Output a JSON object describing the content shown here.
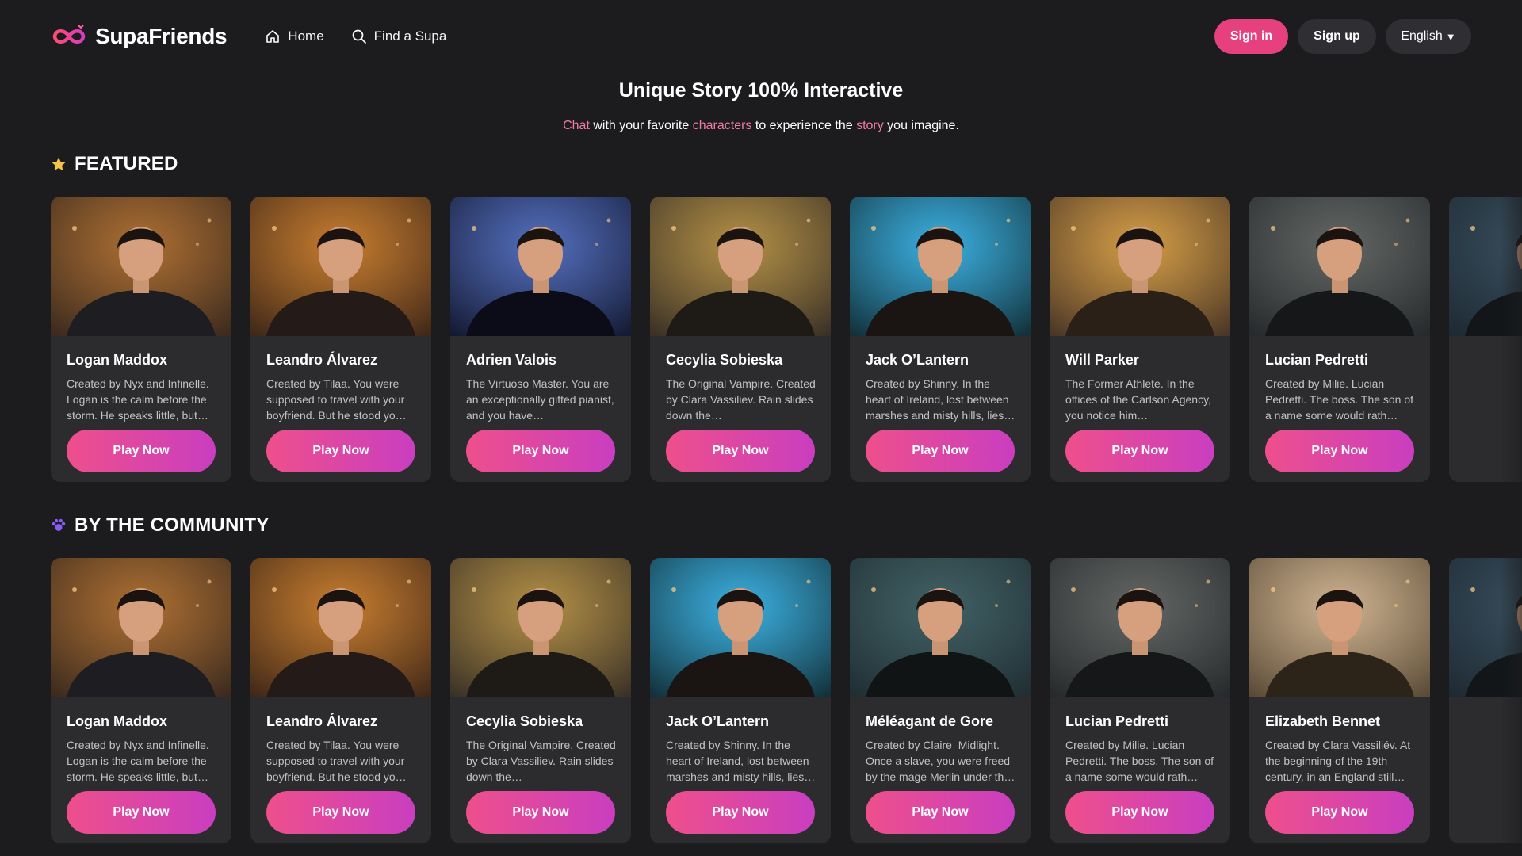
{
  "header": {
    "brand": "SupaFriends",
    "logo_icon": "infinity-heart-logo",
    "nav": [
      {
        "label": "Home",
        "icon": "home-icon"
      },
      {
        "label": "Find a Supa",
        "icon": "search-icon"
      }
    ],
    "sign_in": "Sign in",
    "sign_up": "Sign up",
    "language": "English",
    "language_caret": "▼"
  },
  "hero": {
    "title": "Unique Story 100% Interactive",
    "sub_w1": "Chat",
    "sub_t1": " with your favorite ",
    "sub_w2": "characters",
    "sub_t2": " to experience the ",
    "sub_w3": "story",
    "sub_t3": " you imagine."
  },
  "colors": {
    "accent": "#e6417e",
    "highlight": "#f07aa8",
    "gradient_start": "#ee4f8c",
    "gradient_end": "#c93ec0",
    "card_bg": "#2c2c2e",
    "page_bg": "#1c1c1e",
    "featured_star": "#f5c542",
    "community_icon": "#8a5cf6"
  },
  "featured": {
    "title": "FEATURED",
    "icon": "star-icon",
    "cards": [
      {
        "name": "Logan Maddox",
        "desc": "Created by Nyx and Infinelle. Logan is the calm before the storm. He speaks little, but…",
        "cta": "Play Now"
      },
      {
        "name": "Leandro Álvarez",
        "desc": "Created by Tilaa. You were supposed to travel with your boyfriend. But he stood yo…",
        "cta": "Play Now"
      },
      {
        "name": "Adrien Valois",
        "desc": "The Virtuoso Master. You are an exceptionally gifted pianist, and you have…",
        "cta": "Play Now"
      },
      {
        "name": "Cecylia Sobieska",
        "desc": "The Original Vampire. Created by Clara Vassiliev. Rain slides down the…",
        "cta": "Play Now"
      },
      {
        "name": "Jack O’Lantern",
        "desc": "Created by Shinny. In the heart of Ireland, lost between marshes and misty hills, lies…",
        "cta": "Play Now"
      },
      {
        "name": "Will Parker",
        "desc": "The Former Athlete. In the offices of the Carlson Agency, you notice him…",
        "cta": "Play Now"
      },
      {
        "name": "Lucian Pedretti",
        "desc": "Created by Milie. Lucian Pedretti. The boss. The son of a name some would rath…",
        "cta": "Play Now"
      }
    ]
  },
  "community": {
    "title": "BY THE COMMUNITY",
    "icon": "community-paw-icon",
    "cards": [
      {
        "name": "Logan Maddox",
        "desc": "Created by Nyx and Infinelle. Logan is the calm before the storm. He speaks little, but…",
        "cta": "Play Now"
      },
      {
        "name": "Leandro Álvarez",
        "desc": "Created by Tilaa. You were supposed to travel with your boyfriend. But he stood yo…",
        "cta": "Play Now"
      },
      {
        "name": "Cecylia Sobieska",
        "desc": "The Original Vampire. Created by Clara Vassiliev. Rain slides down the…",
        "cta": "Play Now"
      },
      {
        "name": "Jack O’Lantern",
        "desc": "Created by Shinny. In the heart of Ireland, lost between marshes and misty hills, lies…",
        "cta": "Play Now"
      },
      {
        "name": "Méléagant de Gore",
        "desc": "Created by Claire_Midlight. Once a slave, you were freed by the mage Merlin under th…",
        "cta": "Play Now"
      },
      {
        "name": "Lucian Pedretti",
        "desc": "Created by Milie. Lucian Pedretti. The boss. The son of a name some would rath…",
        "cta": "Play Now"
      },
      {
        "name": "Elizabeth Bennet",
        "desc": "Created by Clara Vassiliév. At the beginning of the 19th century, in an England still…",
        "cta": "Play Now"
      }
    ]
  }
}
